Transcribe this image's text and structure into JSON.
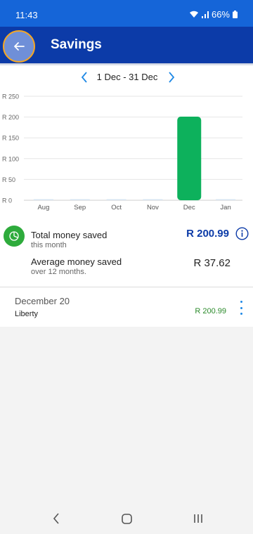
{
  "status_bar": {
    "time": "11:43",
    "battery": "66%"
  },
  "app_bar": {
    "title": "Savings",
    "back_icon": "arrow-left-icon"
  },
  "date_nav": {
    "range": "1 Dec - 31 Dec",
    "prev_icon": "chevron-left-icon",
    "next_icon": "chevron-right-icon"
  },
  "chart_data": {
    "type": "bar",
    "categories": [
      "Aug",
      "Sep",
      "Oct",
      "Nov",
      "Dec",
      "Jan"
    ],
    "values": [
      0,
      0,
      0,
      0,
      200.99,
      0
    ],
    "y_ticks": [
      "R 0",
      "R 50",
      "R 100",
      "R 150",
      "R 200",
      "R 250"
    ],
    "ylim": [
      0,
      250
    ],
    "bar_color": "#0db15c",
    "grid": true
  },
  "summary": {
    "icon": "pie-chart-icon",
    "total_label": "Total money saved",
    "total_sub": "this month",
    "total_value": "R 200.99",
    "average_label": "Average money saved",
    "average_sub": "over 12 months.",
    "average_value": "R 37.62"
  },
  "transactions": [
    {
      "date": "December 20",
      "name": "Liberty",
      "amount": "R 200.99"
    }
  ],
  "colors": {
    "status_bar": "#1565d8",
    "app_bar": "#0c3ba8",
    "accent": "#1e88e5",
    "positive": "#2a8a2a"
  }
}
